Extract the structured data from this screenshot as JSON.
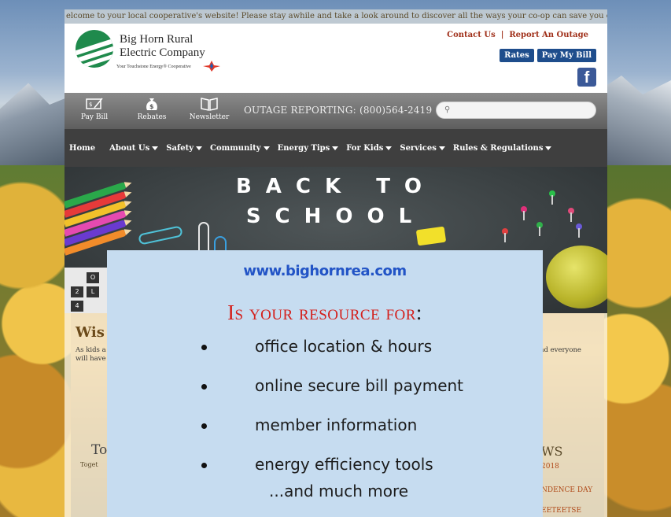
{
  "marquee": "elcome to your local cooperative's website! Please stay awhile and take a look around to discover all the ways your co-op can save you energy and money !",
  "header": {
    "company_line1": "Big Horn Rural",
    "company_line2": "Electric Company",
    "tagline": "Your Touchstone Energy® Cooperative",
    "contact_link": "Contact Us",
    "separator": "|",
    "outage_link": "Report An Outage",
    "rates_button": "Rates",
    "pay_button": "Pay My Bill",
    "facebook_glyph": "f"
  },
  "tools": {
    "pay_bill": "Pay Bill",
    "rebates": "Rebates",
    "newsletter": "Newsletter",
    "outage_text": "OUTAGE REPORTING: (800)564-2419",
    "search_placeholder": ""
  },
  "nav": {
    "items": [
      "Home",
      "About Us",
      "Safety",
      "Community",
      "Energy Tips",
      "For Kids",
      "Services",
      "Rules & Regulations"
    ]
  },
  "hero": {
    "line1": "BACK TO",
    "line2": "SCHOOL",
    "calc_keys": [
      "O",
      "L",
      "2",
      "4"
    ]
  },
  "content": {
    "heading_fragment": "Wis",
    "body_left_1": "As kids a",
    "body_left_2": "will have",
    "body_right": "nd everyone",
    "to_fragment": "To",
    "image_alt_fragment": "Toget",
    "news_fragment": "WS",
    "side_items": [
      "2018",
      "NDENCE DAY",
      "EETEETSE"
    ]
  },
  "popup": {
    "url": "www.bighornrea.com",
    "heading": "Is your resource for",
    "heading_colon": ":",
    "bullets": [
      "office location & hours",
      "online secure bill payment",
      "member information",
      "energy efficiency tools"
    ],
    "more": "...and much more"
  },
  "colors": {
    "header_link": "#a0301a",
    "button_blue": "#1e4d8c",
    "nav_bg": "#3f3f3f",
    "popup_bg": "#c6dcf0",
    "popup_url": "#2254c6",
    "popup_heading": "#d4201c"
  }
}
